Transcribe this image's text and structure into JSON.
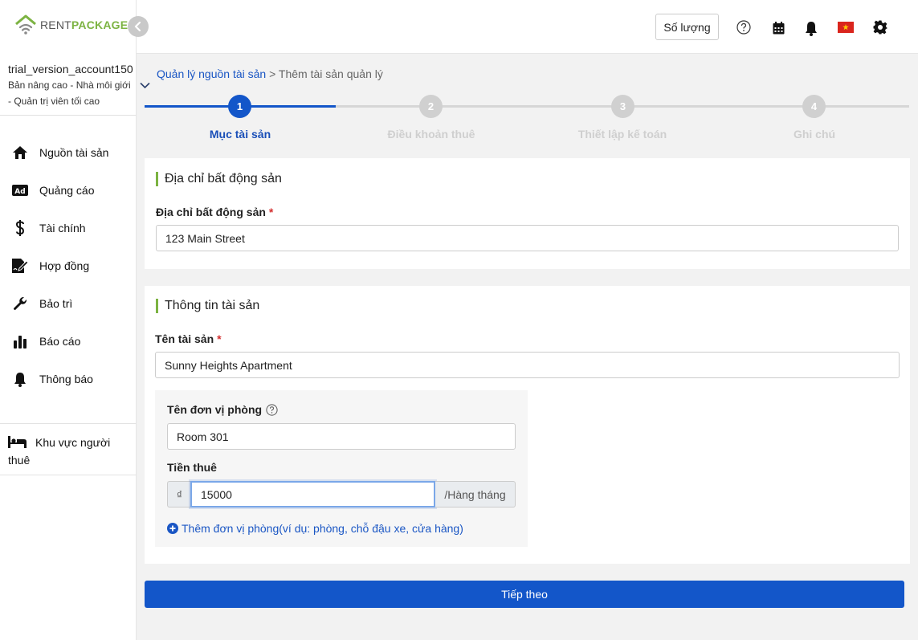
{
  "brand": {
    "rent": "RENT",
    "package": "PACKAGE"
  },
  "account": {
    "name": "trial_version_account150",
    "role": "Bản nâng cao - Nhà môi giới - Quản trị viên tối cao"
  },
  "sidebar": {
    "items": [
      {
        "label": "Nguồn tài sản",
        "icon": "home-icon"
      },
      {
        "label": "Quảng cáo",
        "icon": "ad-icon"
      },
      {
        "label": "Tài chính",
        "icon": "dollar-icon"
      },
      {
        "label": "Hợp đồng",
        "icon": "contract-icon"
      },
      {
        "label": "Bảo trì",
        "icon": "wrench-icon"
      },
      {
        "label": "Báo cáo",
        "icon": "bar-chart-icon"
      },
      {
        "label": "Thông báo",
        "icon": "bell-icon"
      }
    ],
    "tenant_area": "Khu vực người thuê"
  },
  "topbar": {
    "quantity_label": "Số lượng"
  },
  "breadcrumb": {
    "parent": "Quản lý nguồn tài sản",
    "separator": " > ",
    "current": "Thêm tài sản quản lý"
  },
  "stepper": {
    "active_step": 1,
    "steps": [
      {
        "number": "1",
        "label": "Mục tài sản"
      },
      {
        "number": "2",
        "label": "Điều khoản thuê"
      },
      {
        "number": "3",
        "label": "Thiết lập kế toán"
      },
      {
        "number": "4",
        "label": "Ghi chú"
      }
    ]
  },
  "address_card": {
    "title": "Địa chỉ bất động sản",
    "field_label": "Địa chỉ bất động sản",
    "required_mark": "*",
    "value": "123 Main Street"
  },
  "info_card": {
    "title": "Thông tin tài sản",
    "name_label": "Tên tài sản",
    "required_mark": "*",
    "name_value": "Sunny Heights Apartment",
    "unit_label": "Tên đơn vị phòng",
    "unit_value": "Room 301",
    "rent_label": "Tiền thuê",
    "currency": "₫",
    "rent_value": "15000",
    "period": "/Hàng tháng",
    "add_unit_label": "Thêm đơn vị phòng(ví dụ: phòng, chỗ đậu xe, cửa hàng)"
  },
  "next_button": "Tiếp theo",
  "colors": {
    "primary": "#1356c9",
    "accent": "#7cb342",
    "inactive": "#d0d0d0"
  }
}
